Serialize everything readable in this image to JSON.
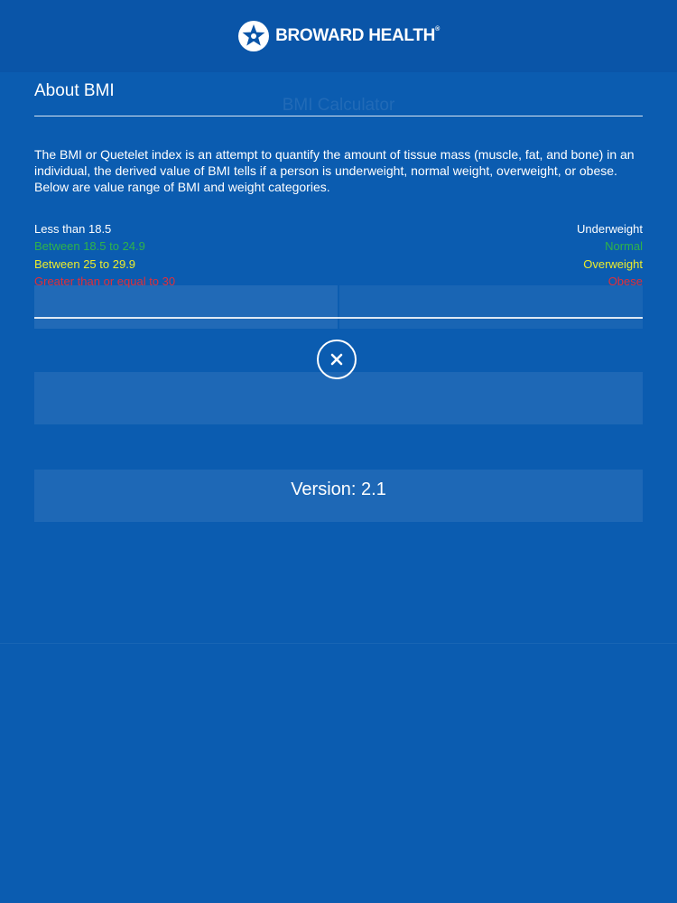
{
  "header": {
    "brand_name": "BROWARD HEALTH",
    "brand_mark": "®",
    "logo_icon": "star-in-circle-icon"
  },
  "background": {
    "title": "BMI Calculator",
    "description": "",
    "segments": [
      "",
      ""
    ],
    "labels": [
      "",
      ""
    ],
    "fields": [
      "",
      ""
    ],
    "button_label": "",
    "footer": [
      "",
      ""
    ]
  },
  "about": {
    "title": "About BMI",
    "description": "The BMI or Quetelet index is an attempt to quantify the amount of tissue mass (muscle, fat, and bone) in an individual, the derived value of BMI tells if a person is underweight, normal weight, overweight, or obese. Below are value range of BMI and weight categories.",
    "ranges": [
      {
        "range": "Less than 18.5",
        "category": "Underweight",
        "color": "#ffffff"
      },
      {
        "range": "Between 18.5 to 24.9",
        "category": "Normal",
        "color": "#2fb34a"
      },
      {
        "range": "Between 25 to 29.9",
        "category": "Overweight",
        "color": "#ecec2a"
      },
      {
        "range": "Greater than or equal to 30",
        "category": "Obese",
        "color": "#e0303a"
      }
    ],
    "close_icon": "close-icon",
    "version": "Version: 2.1"
  }
}
